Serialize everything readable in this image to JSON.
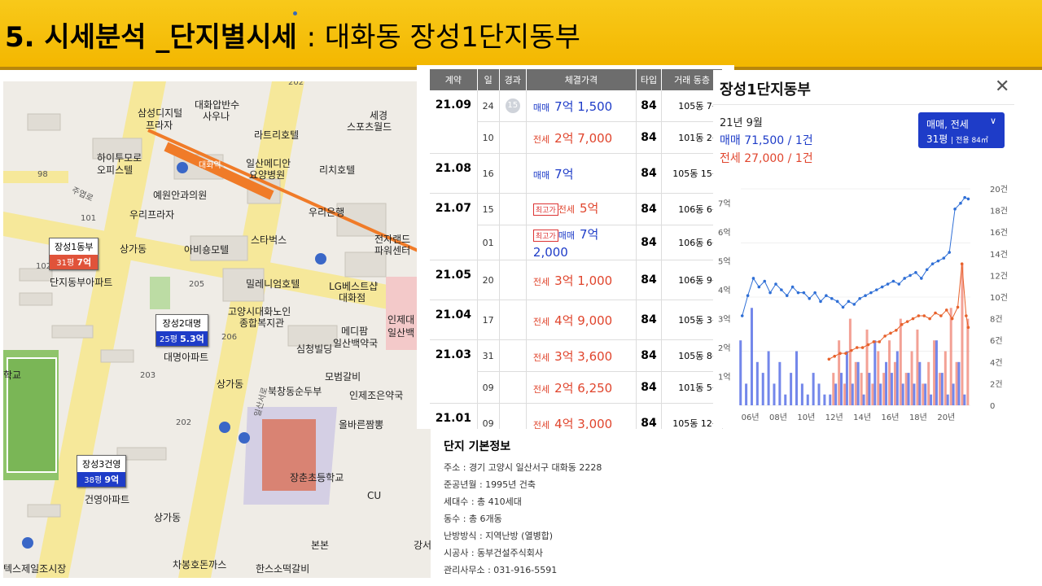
{
  "header": {
    "title_main": "5. 시세분석 _단지별시세",
    "title_sub": ": 대화동 장성1단지동부"
  },
  "map": {
    "labels": [
      "202",
      "삼성디지털",
      "프라자",
      "대화압반수",
      "사우나",
      "라트리호텔",
      "세경",
      "스포츠월드",
      "하이투모로",
      "오피스텔",
      "일산메디안",
      "요양병원",
      "리치호텔",
      "대화역",
      "예원안과의원",
      "우리프라자",
      "우리은행",
      "101",
      "상가동",
      "아비숑모텔",
      "스타벅스",
      "전자랜드",
      "파워센터",
      "102",
      "단지동부아파트",
      "205",
      "밀레니엄호텔",
      "LG베스트샵",
      "대화점",
      "고양시대화노인",
      "종합복지관",
      "인제대",
      "일산백",
      "메디팜",
      "일산백약국",
      "대명아파트",
      "206",
      "심청빌딩",
      "모범갈비",
      "203",
      "상가동",
      "북창동순두부",
      "인제조은약국",
      "202",
      "올바른짬뽕",
      "장춘초등학교",
      "CU",
      "건영아파트",
      "상가동",
      "본본",
      "차봉호돈까스",
      "한스소떡갈비",
      "일산서로",
      "주엽로",
      "98",
      "학교",
      "텍스제일조시장",
      "강서"
    ],
    "pins": [
      {
        "name": "장성1동부",
        "size": "31평",
        "price": "7억"
      },
      {
        "name": "장성2대명",
        "size": "25평",
        "price": "5.3억"
      },
      {
        "name": "장성3건영",
        "size": "38평",
        "price": "9억"
      }
    ]
  },
  "table": {
    "headers": [
      "계약",
      "일",
      "경과",
      "체결가격",
      "타입",
      "거래 동층"
    ],
    "badge": "15",
    "rows": [
      {
        "month": "21.09",
        "day": "24",
        "kind": "매매",
        "price": "7억 1,500",
        "type": "84",
        "floor": "105동 7층",
        "badge": ""
      },
      {
        "month": "",
        "day": "10",
        "kind": "전세",
        "price": "2억 7,000",
        "type": "84",
        "floor": "101동 2층",
        "badge": ""
      },
      {
        "month": "21.08",
        "day": "16",
        "kind": "매매",
        "price": "7억",
        "type": "84",
        "floor": "105동 15층",
        "badge": ""
      },
      {
        "month": "21.07",
        "day": "15",
        "kind": "전세",
        "price": "5억",
        "type": "84",
        "floor": "106동 6층",
        "badge": "최고가"
      },
      {
        "month": "",
        "day": "01",
        "kind": "매매",
        "price": "7억 2,000",
        "type": "84",
        "floor": "106동 6층",
        "badge": "최고가"
      },
      {
        "month": "21.05",
        "day": "20",
        "kind": "전세",
        "price": "3억 1,000",
        "type": "84",
        "floor": "106동 9층",
        "badge": ""
      },
      {
        "month": "21.04",
        "day": "17",
        "kind": "전세",
        "price": "4억 9,000",
        "type": "84",
        "floor": "105동 3층",
        "badge": ""
      },
      {
        "month": "21.03",
        "day": "31",
        "kind": "전세",
        "price": "3억 3,600",
        "type": "84",
        "floor": "105동 8층",
        "badge": ""
      },
      {
        "month": "",
        "day": "09",
        "kind": "전세",
        "price": "2억 6,250",
        "type": "84",
        "floor": "101동 5층",
        "badge": ""
      },
      {
        "month": "21.01",
        "day": "09",
        "kind": "전세",
        "price": "4억 3,000",
        "type": "84",
        "floor": "105동 12층",
        "badge": ""
      }
    ]
  },
  "chart_panel": {
    "title": "장성1단지동부",
    "close": "✕",
    "year_month": "21년 9월",
    "buy_line": "매매 71,500 / 1건",
    "jeon_line": "전세 27,000 / 1건",
    "select_line1": "매매, 전세",
    "select_line2": "31평",
    "select_line3": "| 전용 84㎡",
    "colors": {
      "buy": "#2f6fd6",
      "jeon": "#e8622c"
    }
  },
  "chart_data": {
    "type": "line",
    "x_tick_labels": [
      "06년",
      "08년",
      "10년",
      "12년",
      "14년",
      "16년",
      "18년",
      "20년"
    ],
    "y_left_labels": [
      "1억",
      "2억",
      "3억",
      "4억",
      "5억",
      "6억",
      "7억"
    ],
    "y_right_labels": [
      "0",
      "2건",
      "4건",
      "6건",
      "8건",
      "10건",
      "12건",
      "14건",
      "16건",
      "18건",
      "20건"
    ],
    "ylim_left": [
      0,
      7.5
    ],
    "ylim_right": [
      0,
      20
    ],
    "xlim": [
      2005.5,
      2021.9
    ],
    "series": [
      {
        "name": "매매",
        "x": [
          2005.6,
          2006.0,
          2006.4,
          2006.8,
          2007.2,
          2007.6,
          2008.0,
          2008.4,
          2008.8,
          2009.2,
          2009.6,
          2010.0,
          2010.4,
          2010.8,
          2011.2,
          2011.6,
          2012.0,
          2012.4,
          2012.8,
          2013.2,
          2013.6,
          2014.0,
          2014.4,
          2014.8,
          2015.2,
          2015.6,
          2016.0,
          2016.4,
          2016.8,
          2017.2,
          2017.6,
          2018.0,
          2018.4,
          2018.8,
          2019.2,
          2019.6,
          2020.0,
          2020.4,
          2020.8,
          2021.2,
          2021.5,
          2021.75
        ],
        "values": [
          3.1,
          3.8,
          4.4,
          4.1,
          4.3,
          3.9,
          4.2,
          4.0,
          3.8,
          4.1,
          3.9,
          3.9,
          3.7,
          3.9,
          3.6,
          3.8,
          3.7,
          3.6,
          3.4,
          3.6,
          3.5,
          3.7,
          3.8,
          3.9,
          4.0,
          4.1,
          4.2,
          4.3,
          4.2,
          4.4,
          4.5,
          4.6,
          4.4,
          4.7,
          4.9,
          5.0,
          5.1,
          5.3,
          6.8,
          7.0,
          7.2,
          7.15
        ]
      },
      {
        "name": "전세",
        "x": [
          2011.8,
          2012.2,
          2012.6,
          2013.0,
          2013.4,
          2013.8,
          2014.2,
          2014.6,
          2015.0,
          2015.4,
          2015.8,
          2016.2,
          2016.6,
          2017.0,
          2017.4,
          2017.8,
          2018.2,
          2018.6,
          2019.0,
          2019.4,
          2019.8,
          2020.2,
          2020.6,
          2021.0,
          2021.3,
          2021.6,
          2021.75
        ],
        "values": [
          1.6,
          1.7,
          1.8,
          1.8,
          1.9,
          2.0,
          2.0,
          2.1,
          2.2,
          2.2,
          2.4,
          2.5,
          2.6,
          2.8,
          2.9,
          3.0,
          3.1,
          3.1,
          3.0,
          3.2,
          3.1,
          3.3,
          3.0,
          3.4,
          4.9,
          3.1,
          2.7
        ]
      }
    ],
    "volume_bars": {
      "x": [
        2005.6,
        2006.0,
        2006.4,
        2006.8,
        2007.2,
        2007.6,
        2008.0,
        2008.4,
        2008.8,
        2009.2,
        2009.6,
        2010.0,
        2010.4,
        2010.8,
        2011.2,
        2011.6,
        2012.0,
        2012.4,
        2012.8,
        2013.2,
        2013.6,
        2014.0,
        2014.4,
        2014.8,
        2015.2,
        2015.6,
        2016.0,
        2016.4,
        2016.8,
        2017.2,
        2017.6,
        2018.0,
        2018.4,
        2018.8,
        2019.2,
        2019.6,
        2020.0,
        2020.4,
        2020.8,
        2021.2,
        2021.6
      ],
      "buy_counts": [
        6,
        2,
        9,
        4,
        3,
        5,
        2,
        4,
        1,
        3,
        5,
        2,
        1,
        3,
        2,
        1,
        1,
        2,
        3,
        5,
        2,
        4,
        1,
        3,
        6,
        2,
        4,
        3,
        5,
        2,
        3,
        2,
        4,
        2,
        1,
        6,
        3,
        1,
        2,
        4,
        1
      ],
      "jeon_counts": [
        0,
        0,
        0,
        0,
        0,
        0,
        0,
        0,
        0,
        0,
        0,
        0,
        0,
        0,
        0,
        0,
        3,
        6,
        2,
        8,
        4,
        3,
        7,
        2,
        5,
        3,
        6,
        4,
        8,
        3,
        5,
        7,
        2,
        4,
        6,
        3,
        5,
        9,
        4,
        13,
        8
      ]
    }
  },
  "info": {
    "title": "단지 기본정보",
    "rows": [
      "주소 : 경기 고양시 일산서구 대화동 2228",
      "준공년월 : 1995년 건축",
      "세대수 : 총 410세대",
      "동수 : 총 6개동",
      "난방방식 : 지역난방 (열병합)",
      "시공사 : 동부건설주식회사",
      "관리사무소 : 031-916-5591"
    ]
  }
}
